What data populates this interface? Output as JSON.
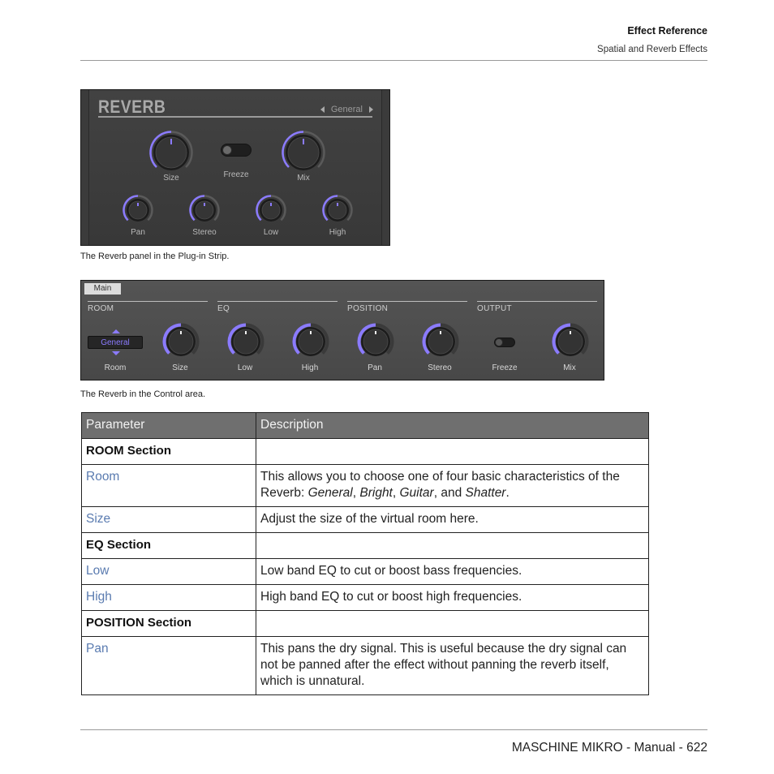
{
  "header": {
    "title": "Effect Reference",
    "subtitle": "Spatial and Reverb Effects"
  },
  "plugin_strip": {
    "title": "REVERB",
    "preset": "General",
    "accent_color": "#8b7bff",
    "top_row": [
      {
        "name": "size",
        "label": "Size",
        "type": "knob",
        "value": 0.5
      },
      {
        "name": "freeze",
        "label": "Freeze",
        "type": "toggle",
        "on": false
      },
      {
        "name": "mix",
        "label": "Mix",
        "type": "knob",
        "value": 0.5
      }
    ],
    "bottom_row": [
      {
        "name": "pan",
        "label": "Pan",
        "value": 0.5
      },
      {
        "name": "stereo",
        "label": "Stereo",
        "value": 0.5
      },
      {
        "name": "low",
        "label": "Low",
        "value": 0.5
      },
      {
        "name": "high",
        "label": "High",
        "value": 0.5
      }
    ]
  },
  "caption1": "The Reverb panel in the Plug-in Strip.",
  "control_area": {
    "tab": "Main",
    "sections": [
      {
        "name": "room",
        "label": "ROOM"
      },
      {
        "name": "eq",
        "label": "EQ"
      },
      {
        "name": "position",
        "label": "POSITION"
      },
      {
        "name": "output",
        "label": "OUTPUT"
      }
    ],
    "room_selector": {
      "value": "General",
      "label": "Room"
    },
    "controls": [
      {
        "name": "size",
        "label": "Size",
        "type": "knob",
        "value": 0.5
      },
      {
        "name": "low",
        "label": "Low",
        "type": "knob",
        "value": 0.5
      },
      {
        "name": "high",
        "label": "High",
        "type": "knob",
        "value": 0.5
      },
      {
        "name": "pan",
        "label": "Pan",
        "type": "knob",
        "value": 0.5
      },
      {
        "name": "stereo",
        "label": "Stereo",
        "type": "knob",
        "value": 0.5
      },
      {
        "name": "freeze",
        "label": "Freeze",
        "type": "toggle",
        "on": false
      },
      {
        "name": "mix",
        "label": "Mix",
        "type": "knob",
        "value": 0.5
      }
    ]
  },
  "caption2": "The Reverb in the Control area.",
  "table": {
    "headers": [
      "Parameter",
      "Description"
    ],
    "rows": [
      {
        "section": "ROOM Section"
      },
      {
        "param": "Room",
        "desc_parts": [
          "This allows you to choose one of four basic characteristics of the Reverb: ",
          {
            "i": "General"
          },
          ", ",
          {
            "i": "Bright"
          },
          ", ",
          {
            "i": "Guitar"
          },
          ", and ",
          {
            "i": "Shatter"
          },
          "."
        ]
      },
      {
        "param": "Size",
        "desc_parts": [
          "Adjust the size of the virtual room here."
        ]
      },
      {
        "section": "EQ Section"
      },
      {
        "param": "Low",
        "desc_parts": [
          "Low band EQ to cut or boost bass frequencies."
        ]
      },
      {
        "param": "High",
        "desc_parts": [
          "High band EQ to cut or boost high frequencies."
        ]
      },
      {
        "section": "POSITION Section"
      },
      {
        "param": "Pan",
        "desc_parts": [
          "This pans the dry signal. This is useful because the dry signal can not be panned after the effect without panning the reverb itself, which is unnatural."
        ]
      }
    ]
  },
  "footer": "MASCHINE MIKRO - Manual - 622"
}
